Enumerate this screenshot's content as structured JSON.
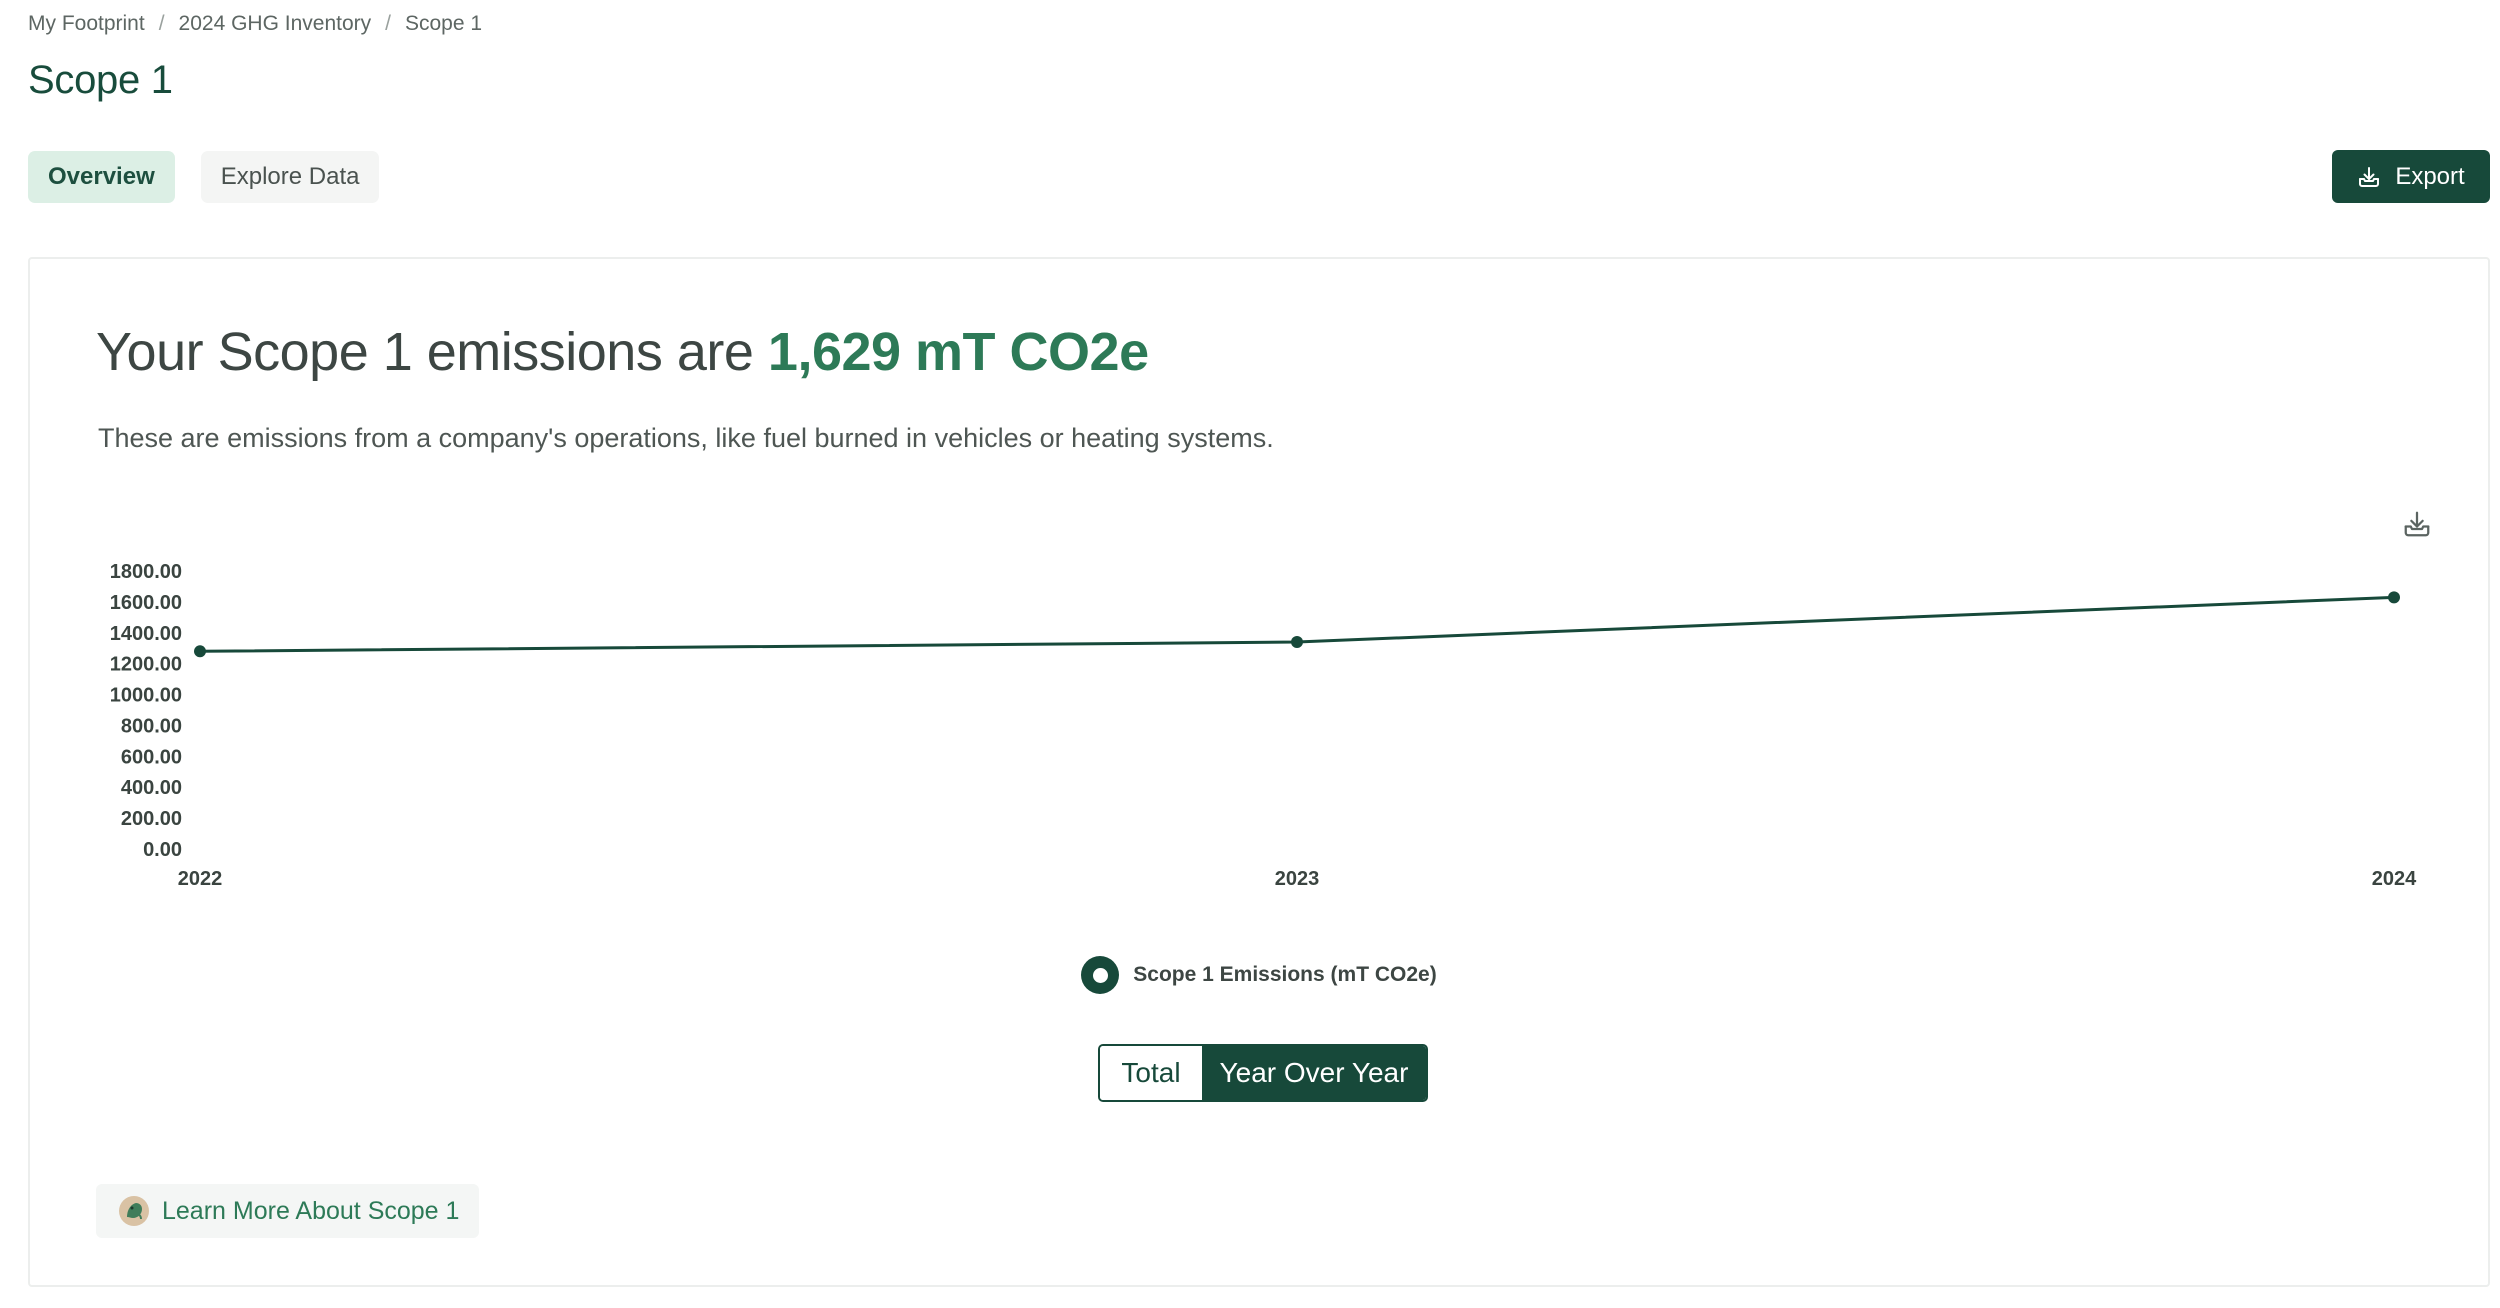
{
  "breadcrumb": [
    {
      "label": "My Footprint"
    },
    {
      "label": "2024 GHG Inventory"
    },
    {
      "label": "Scope 1"
    }
  ],
  "breadcrumb_separator": "/",
  "page": {
    "title": "Scope 1"
  },
  "tabs": [
    {
      "label": "Overview",
      "active": true
    },
    {
      "label": "Explore Data",
      "active": false
    }
  ],
  "toolbar": {
    "export_label": "Export",
    "export_icon": "download-tray-icon"
  },
  "summary": {
    "headline_prefix": "Your Scope 1 emissions are",
    "headline_value": "1,629 mT CO2e",
    "description": "These are emissions from a company's operations, like fuel burned in vehicles or heating systems."
  },
  "chart_toolbar": {
    "download_icon": "download-tray-icon"
  },
  "chart_data": {
    "type": "line",
    "x": [
      "2022",
      "2023",
      "2024"
    ],
    "series": [
      {
        "name": "Scope 1 Emissions (mT CO2e)",
        "values": [
          1280,
          1340,
          1629
        ],
        "color": "#17493a"
      }
    ],
    "ylim": [
      0,
      1800
    ],
    "yticks": [
      "0.00",
      "200.00",
      "400.00",
      "600.00",
      "800.00",
      "1000.00",
      "1200.00",
      "1400.00",
      "1600.00",
      "1800.00"
    ],
    "grid": false,
    "legend": "bottom-center"
  },
  "view_toggle": [
    {
      "label": "Total",
      "active": false
    },
    {
      "label": "Year Over Year",
      "active": true
    }
  ],
  "learn_more": {
    "label": "Learn More About Scope 1",
    "icon": "globe-leaf-icon"
  },
  "colors": {
    "brand_dark": "#17493a",
    "accent_green": "#2d7a57",
    "tab_active_bg": "#dcefe5"
  }
}
